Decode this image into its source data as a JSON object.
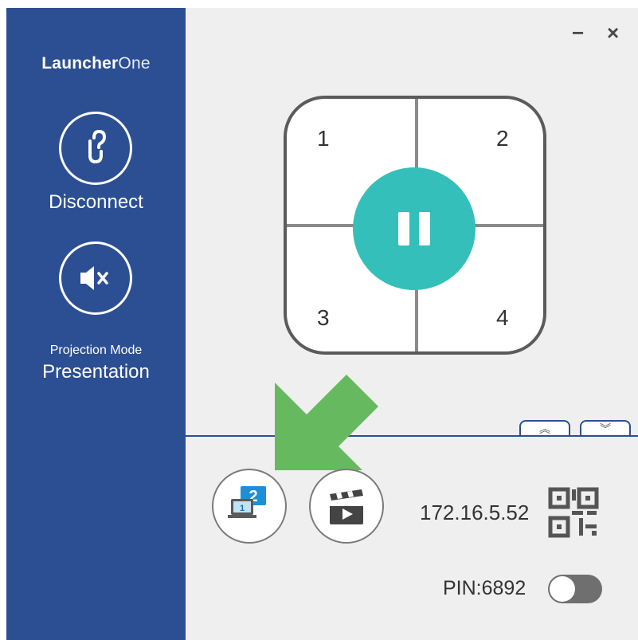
{
  "brand": {
    "bold": "Launcher",
    "light": "One"
  },
  "sidebar": {
    "disconnect_label": "Disconnect",
    "projection_mode_label": "Projection Mode",
    "projection_mode_value": "Presentation"
  },
  "window": {
    "minimize_glyph": "−",
    "close_glyph": "×"
  },
  "split_pad": {
    "quadrants": [
      "1",
      "2",
      "3",
      "4"
    ],
    "center_button": "pause-icon"
  },
  "tabs": {
    "expand_glyph": "︽",
    "collapse_glyph": "︾"
  },
  "bottom": {
    "ip_address": "172.16.5.52",
    "pin_label": "PIN:6892",
    "pin_toggle_on": false,
    "extend_screen_number_big": "2",
    "extend_screen_number_small": "1"
  },
  "colors": {
    "sidebar": "#2c4f93",
    "accent_teal": "#35bfba",
    "arrow_green": "#67b960",
    "panel_bg": "#efefef"
  },
  "icons": [
    "link-question-icon",
    "mute-icon",
    "pause-icon",
    "extend-screen-icon",
    "clapperboard-icon",
    "qr-code-icon"
  ]
}
